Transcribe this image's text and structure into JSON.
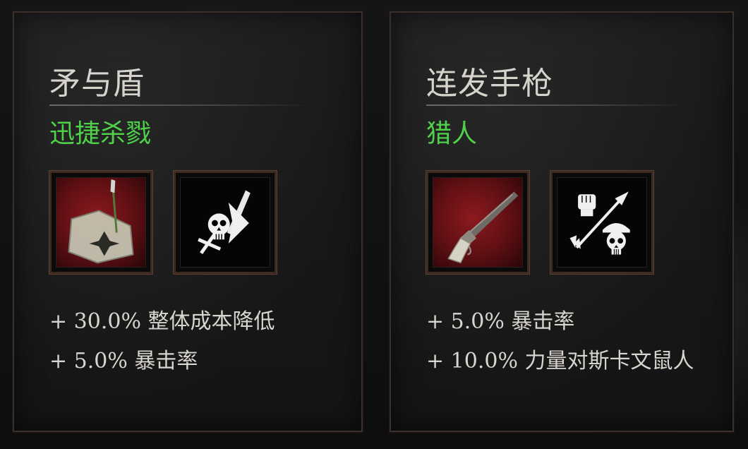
{
  "cards": [
    {
      "title": "矛与盾",
      "subtitle": "迅捷杀戮",
      "weapon_icon": "spear-shield-icon",
      "perk_icon": "skull-blade-icon",
      "stats": [
        "+ 30.0% 整体成本降低",
        "+ 5.0% 暴击率"
      ]
    },
    {
      "title": "连发手枪",
      "subtitle": "猎人",
      "weapon_icon": "repeater-pistol-icon",
      "perk_icon": "fist-arrow-skull-icon",
      "stats": [
        "+ 5.0% 暴击率",
        "+ 10.0% 力量对斯卡文鼠人"
      ]
    }
  ],
  "colors": {
    "subtitle": "#4fd14a",
    "title": "#d6d2cc",
    "stat_text": "#d8d4ce",
    "weapon_bg": "#8c1a1f",
    "frame": "#3d2b22"
  }
}
